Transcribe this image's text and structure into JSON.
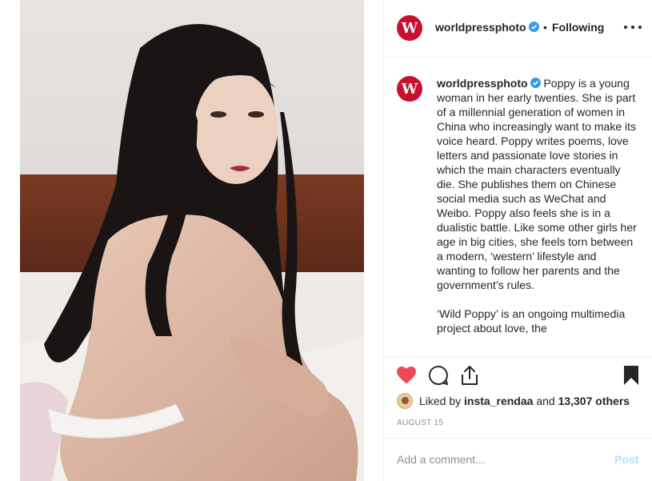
{
  "post": {
    "photo_alt": "worldpressphoto post photo",
    "account": {
      "username": "worldpressphoto",
      "avatar_letter": "W",
      "avatar_color": "#c8102e",
      "verified_icon": "verified-badge-icon",
      "separator": "•",
      "follow_status": "Following"
    },
    "more_icon": "more-options-icon",
    "caption": {
      "username": "worldpressphoto",
      "avatar_letter": "W",
      "paragraph1": "Poppy is a young woman in her early twenties. She is part of a millennial generation of women in China who increasingly want to make its voice heard. Poppy writes poems, love letters and passionate love stories in which the main characters eventually die. She publishes them on Chinese social media such as WeChat and Weibo. Poppy also feels she is in a dualistic battle. Like some other girls her age in big cities, she feels torn between a modern, ‘western’ lifestyle and wanting to follow her parents and the government’s rules.",
      "paragraph2": "‘Wild Poppy’ is an ongoing multimedia project about love, the"
    },
    "actions": {
      "like_icon": "heart-filled-icon",
      "like_color": "#ed4956",
      "comment_icon": "comment-icon",
      "share_icon": "share-icon",
      "save_icon": "bookmark-filled-icon"
    },
    "likes": {
      "prefix": "Liked by",
      "liker": "insta_rendaa",
      "joiner": "and",
      "others": "13,307 others"
    },
    "date": "AUGUST 15",
    "comment_box": {
      "placeholder": "Add a comment...",
      "post_label": "Post",
      "post_color": "#b2dffc"
    }
  }
}
